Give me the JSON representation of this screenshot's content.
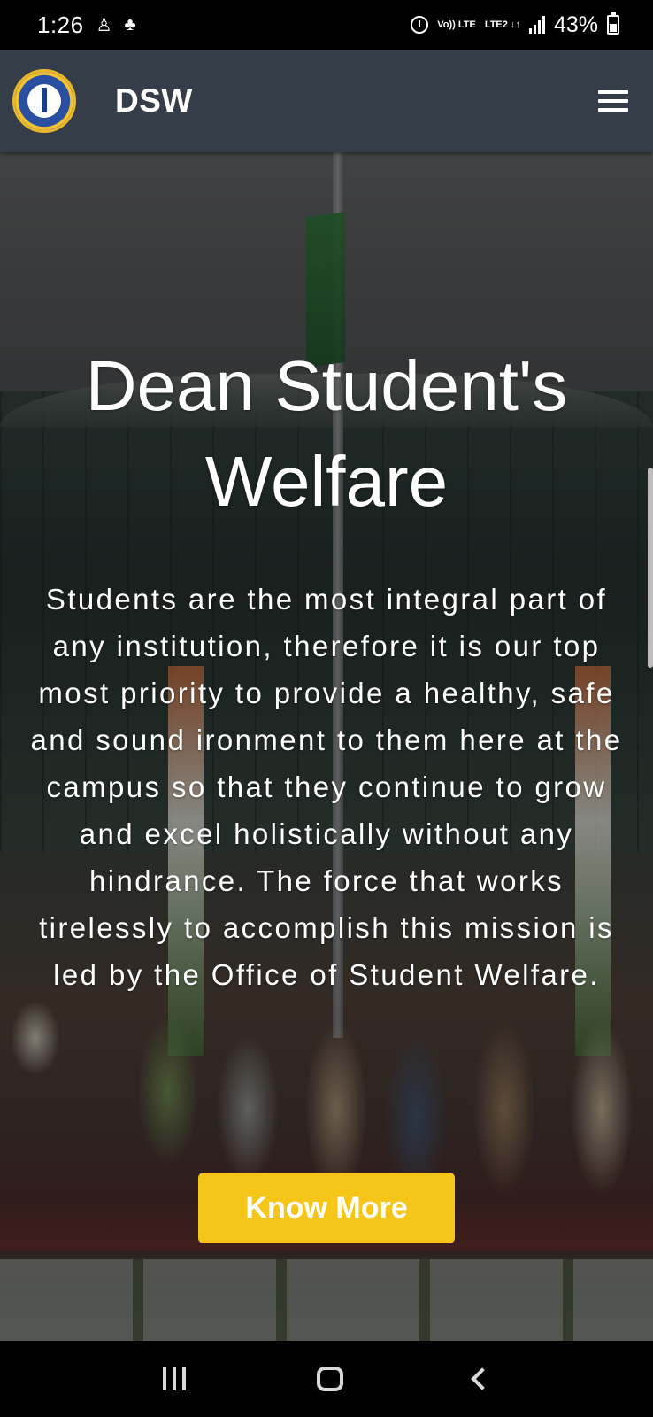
{
  "status_bar": {
    "time": "1:26",
    "notification_icons": [
      "person-icon",
      "plant-icon"
    ],
    "network_labels": [
      "Vo)) LTE",
      "LTE2 ↓↑"
    ],
    "battery_percent": "43%"
  },
  "header": {
    "brand": "DSW",
    "logo_icon": "institute-logo-icon",
    "menu_icon": "hamburger-menu-icon"
  },
  "hero": {
    "title": "Dean Student's Welfare",
    "description": "Students are the most integral part of any institution, therefore it is our top most priority to provide a healthy, safe and sound ironment to them here at the campus so that they continue to grow and excel holistically without any hindrance. The force that works tirelessly to accomplish this mission is led by the Office of Student Welfare.",
    "button_label": "Know More",
    "button_color": "#f5c518"
  },
  "nav_bar": {
    "icons": [
      "recent-apps-icon",
      "home-icon",
      "back-icon"
    ]
  },
  "colors": {
    "header_bg": "#353d49",
    "accent": "#f5c518"
  }
}
